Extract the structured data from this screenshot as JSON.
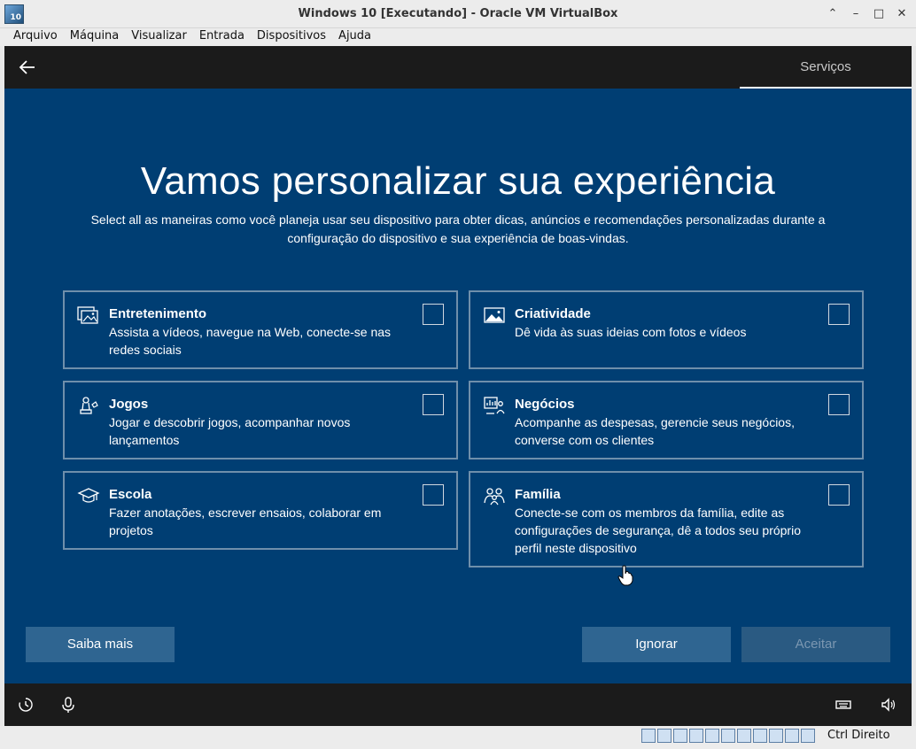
{
  "window": {
    "title": "Windows 10 [Executando] - Oracle VM VirtualBox",
    "logo_text": "10",
    "buttons": [
      "⌃",
      "–",
      "□",
      "✕"
    ]
  },
  "menu": [
    "Arquivo",
    "Máquina",
    "Visualizar",
    "Entrada",
    "Dispositivos",
    "Ajuda"
  ],
  "oobe": {
    "step": "Serviços",
    "headline": "Vamos personalizar sua experiência",
    "subtitle": "Select all as maneiras como você planeja usar seu dispositivo para obter dicas, anúncios e recomendações personalizadas durante a configuração do dispositivo e sua experiência de boas-vindas.",
    "cards": [
      {
        "icon": "image-gallery-icon",
        "title": "Entretenimento",
        "desc": "Assista a vídeos, navegue na Web, conecte-se nas redes sociais",
        "checked": false
      },
      {
        "icon": "picture-icon",
        "title": "Criatividade",
        "desc": "Dê vida às suas ideias com fotos e vídeos",
        "checked": false
      },
      {
        "icon": "game-pieces-icon",
        "title": "Jogos",
        "desc": "Jogar e descobrir jogos, acompanhar novos lançamentos",
        "checked": false
      },
      {
        "icon": "business-chart-icon",
        "title": "Negócios",
        "desc": "Acompanhe as despesas, gerencie seus negócios, converse com os clientes",
        "checked": false
      },
      {
        "icon": "graduation-cap-icon",
        "title": "Escola",
        "desc": "Fazer anotações, escrever ensaios, colaborar em projetos",
        "checked": false
      },
      {
        "icon": "family-icon",
        "title": "Família",
        "desc": "Conecte-se com os membros da família, edite as configurações de segurança, dê a todos seu próprio perfil neste dispositivo",
        "checked": false
      }
    ],
    "buttons": {
      "learn_more": "Saiba mais",
      "skip": "Ignorar",
      "accept": "Aceitar"
    }
  },
  "statusbar": {
    "host_key": "Ctrl Direito"
  },
  "colors": {
    "background": "#003e73",
    "header": "#1b1b1b",
    "button": "#2f6591"
  }
}
